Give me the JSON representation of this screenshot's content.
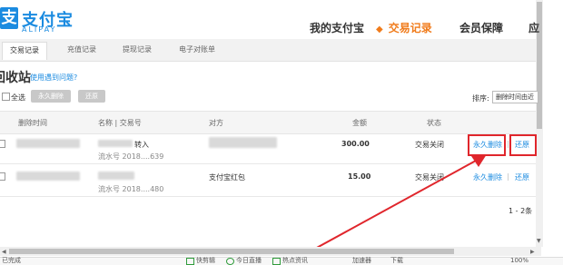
{
  "logo": {
    "mark": "支",
    "name_cn": "支付宝",
    "name_en": "ALIPAY"
  },
  "nav": {
    "items": [
      {
        "label": "我的支付宝",
        "active": false
      },
      {
        "label": "交易记录",
        "active": true
      },
      {
        "label": "会员保障",
        "active": false
      },
      {
        "label": "应",
        "active": false
      }
    ]
  },
  "subnav": {
    "items": [
      {
        "label": "交易记录",
        "active": true
      },
      {
        "label": "充值记录",
        "active": false
      },
      {
        "label": "提现记录",
        "active": false
      },
      {
        "label": "电子对账单",
        "active": false
      }
    ]
  },
  "page": {
    "title": "回收站",
    "help_link": "使用遇到问题?"
  },
  "toolbar": {
    "select_all": "全选",
    "delete_button": "永久删除",
    "restore_button": "还原",
    "sort_label": "排序:",
    "sort_value": "删除时间由近"
  },
  "table": {
    "headers": [
      "删除时间",
      "名称 | 交易号",
      "对方",
      "金额",
      "状态"
    ],
    "rows": [
      {
        "name_suffix": "转入",
        "serial": "流水号 2018....639",
        "counterparty": "",
        "amount": "300.00",
        "status": "交易关闭",
        "delete_action": "永久删除",
        "separator": "|",
        "restore_action": "还原"
      },
      {
        "name_suffix": "",
        "serial": "流水号 2018....480",
        "counterparty": "支付宝红包",
        "amount": "15.00",
        "status": "交易关闭",
        "delete_action": "永久删除",
        "separator": "|",
        "restore_action": "还原"
      }
    ],
    "pager": "1 - 2条"
  },
  "statusbar": {
    "left_text": "已完成",
    "items": [
      "快剪辑",
      "今日直播",
      "热点资讯",
      "加速器",
      "下载",
      "100%"
    ]
  },
  "colors": {
    "brand": "#1b8be0",
    "accent": "#f07b1b",
    "annotation": "#e0262c"
  }
}
